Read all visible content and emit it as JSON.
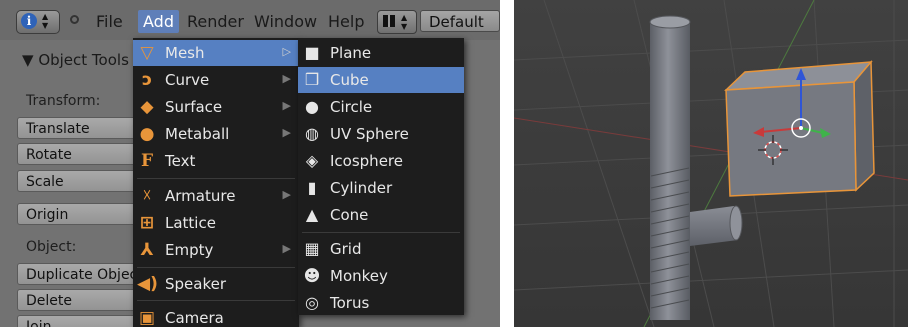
{
  "header": {
    "menus": [
      "File",
      "Add",
      "Render",
      "Window",
      "Help"
    ],
    "active_menu": "Add",
    "screen_layout": "Default"
  },
  "tool_shelf": {
    "title": "Object Tools",
    "transform_label": "Transform:",
    "transform_buttons": [
      "Translate",
      "Rotate",
      "Scale"
    ],
    "origin_button": "Origin",
    "object_label": "Object:",
    "object_buttons": [
      "Duplicate Objects",
      "Delete",
      "Join"
    ]
  },
  "add_menu": {
    "items": [
      {
        "label": "Mesh",
        "icon": "mesh-icon",
        "submenu": true,
        "highlighted": true
      },
      {
        "label": "Curve",
        "icon": "curve-icon",
        "submenu": true
      },
      {
        "label": "Surface",
        "icon": "surface-icon",
        "submenu": true
      },
      {
        "label": "Metaball",
        "icon": "metaball-icon",
        "submenu": true
      },
      {
        "label": "Text",
        "icon": "text-icon",
        "submenu": false
      },
      {
        "label": "Armature",
        "icon": "armature-icon",
        "submenu": true
      },
      {
        "label": "Lattice",
        "icon": "lattice-icon",
        "submenu": false
      },
      {
        "label": "Empty",
        "icon": "empty-icon",
        "submenu": true
      },
      {
        "label": "Speaker",
        "icon": "speaker-icon",
        "submenu": false
      },
      {
        "label": "Camera",
        "icon": "camera-icon",
        "submenu": false
      }
    ]
  },
  "mesh_menu": {
    "items": [
      {
        "label": "Plane",
        "icon": "plane-icon"
      },
      {
        "label": "Cube",
        "icon": "cube-icon",
        "highlighted": true
      },
      {
        "label": "Circle",
        "icon": "circle-icon"
      },
      {
        "label": "UV Sphere",
        "icon": "uv-sphere-icon"
      },
      {
        "label": "Icosphere",
        "icon": "icosphere-icon"
      },
      {
        "label": "Cylinder",
        "icon": "cylinder-icon"
      },
      {
        "label": "Cone",
        "icon": "cone-icon"
      },
      {
        "label": "Grid",
        "icon": "grid-icon"
      },
      {
        "label": "Monkey",
        "icon": "monkey-icon"
      },
      {
        "label": "Torus",
        "icon": "torus-icon"
      }
    ]
  },
  "colors": {
    "highlight": "#5680c2",
    "menu_bg": "#1d1d1d",
    "menu_icon": "#e8953a",
    "selection_outline": "#e8953a",
    "viewport_bg": "#3f3f3f",
    "axis_x": "#c93a3a",
    "axis_y": "#3fb34a",
    "axis_z": "#2f55d6"
  }
}
